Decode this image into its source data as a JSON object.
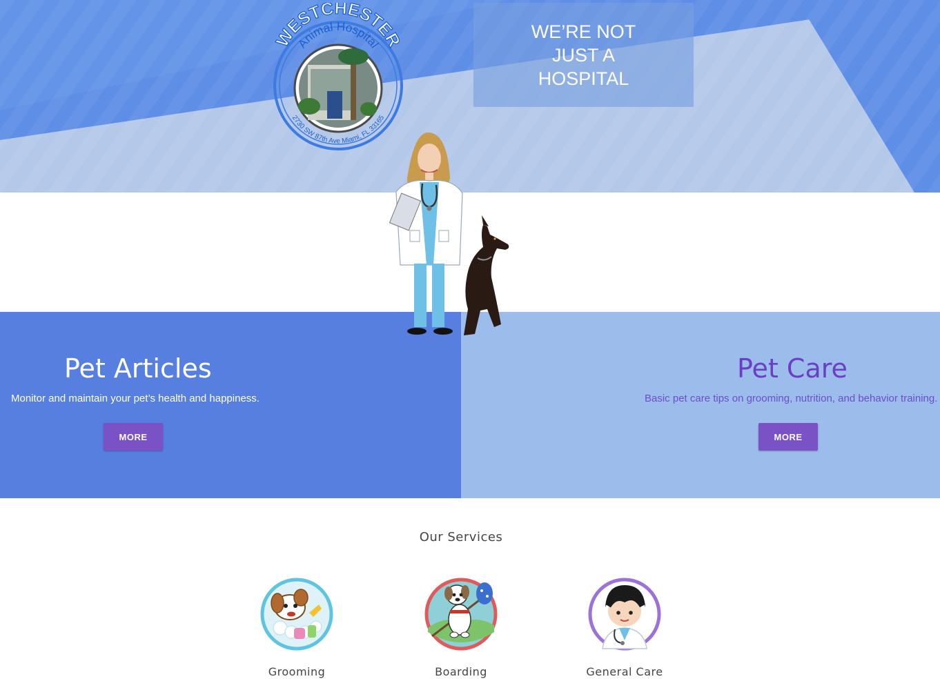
{
  "hero": {
    "logo": {
      "arc_top": "WESTCHESTER",
      "arc_sub": "Animal Hospital",
      "arc_bottom": "2730 SW 87th Ave Miami, FL 33165"
    },
    "tagline": "WE’RE NOT JUST A HOSPITAL"
  },
  "panels": [
    {
      "title": "Pet Articles",
      "description": "Monitor and maintain your pet’s health and happiness.",
      "button_label": "MORE"
    },
    {
      "title": "Pet Care",
      "description": "Basic pet care tips on grooming, nutrition, and behavior training.",
      "button_label": "MORE"
    }
  ],
  "services": {
    "title": "Our Services",
    "items": [
      {
        "label": "Grooming",
        "icon": "grooming-dog-icon",
        "ring_color": "#5ec4e0"
      },
      {
        "label": "Boarding",
        "icon": "boarding-dog-icon",
        "ring_color": "#e05a5a"
      },
      {
        "label": "General Care",
        "icon": "vet-doctor-icon",
        "ring_color": "#9b72d8"
      }
    ]
  },
  "colors": {
    "hero_light": "#b4c8ea",
    "hero_dark": "#5f8ee6",
    "panel_left": "#577fe0",
    "panel_right": "#9cbcec",
    "button": "#7a52c6"
  }
}
